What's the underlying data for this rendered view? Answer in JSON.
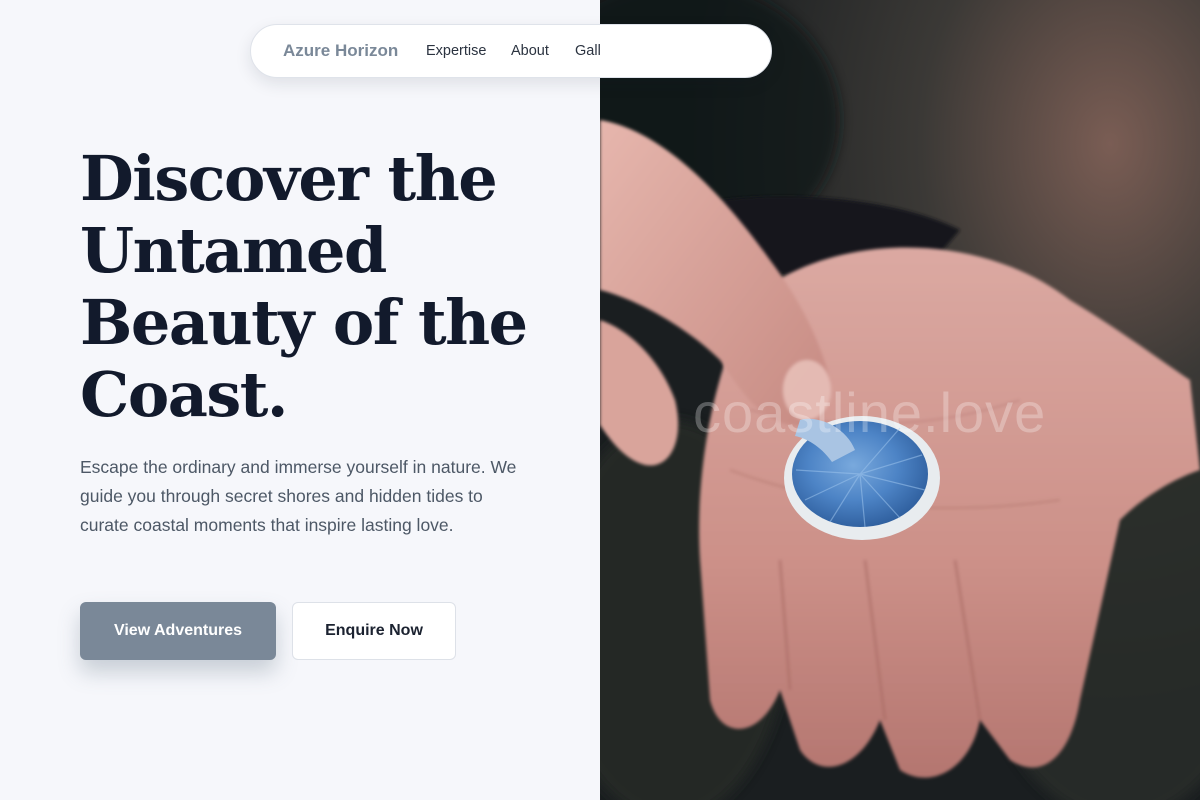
{
  "nav": {
    "brand": "Azure Horizon",
    "links": [
      "Expertise",
      "About",
      "Gall"
    ]
  },
  "hero": {
    "title_lines": [
      "Discover the",
      "Untamed",
      "Beauty of the",
      "Coast."
    ],
    "description": "Escape the ordinary and immerse yourself in nature. We guide you through secret shores and hidden tides to curate coastal moments that inspire lasting love.",
    "primary_button": "View Adventures",
    "secondary_button": "Enquire Now"
  },
  "image": {
    "watermark": "coastline.love"
  },
  "colors": {
    "background": "#f6f7fb",
    "heading": "#121a2c",
    "body_text": "#4d5866",
    "accent": "#7a8898",
    "mushroom_blue": "#4f86c8"
  }
}
